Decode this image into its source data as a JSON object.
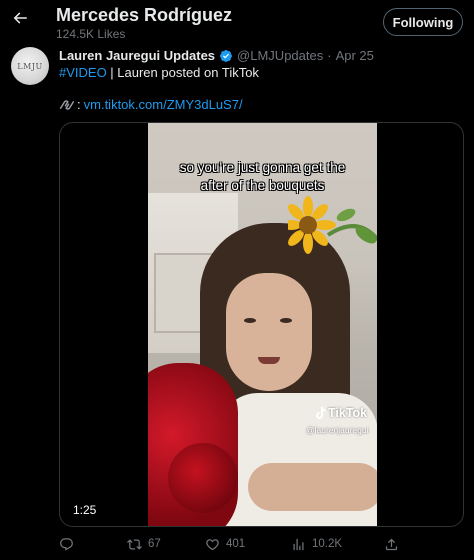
{
  "header": {
    "back_icon": "arrow-left-icon",
    "name": "Mercedes Rodríguez",
    "likes_count": "124.5K Likes",
    "follow_label": "Following"
  },
  "tweet": {
    "avatar_text": "LMJU",
    "author_name": "Lauren Jauregui Updates",
    "handle": "@LMJUpdates",
    "separator": "·",
    "date": "Apr 25",
    "hashtag": "#VIDEO",
    "text": " | Lauren posted on TikTok",
    "link_emoji": "link-icon",
    "link_prefix": ":",
    "link": "vm.tiktok.com/ZMY3dLuS7/"
  },
  "media": {
    "caption_line1": "so you're just gonna get the",
    "caption_line2": "after of the bouquets",
    "tiktok_label": "TikTok",
    "tiktok_user": "@laurenjauregui",
    "duration": "1:25"
  },
  "actions": {
    "reply_count": "",
    "retweet_count": "67",
    "like_count": "401",
    "views_count": "10.2K"
  },
  "colors": {
    "background": "#000000",
    "text": "#e7e9ea",
    "muted": "#71767b",
    "accent": "#1d9bf0"
  }
}
